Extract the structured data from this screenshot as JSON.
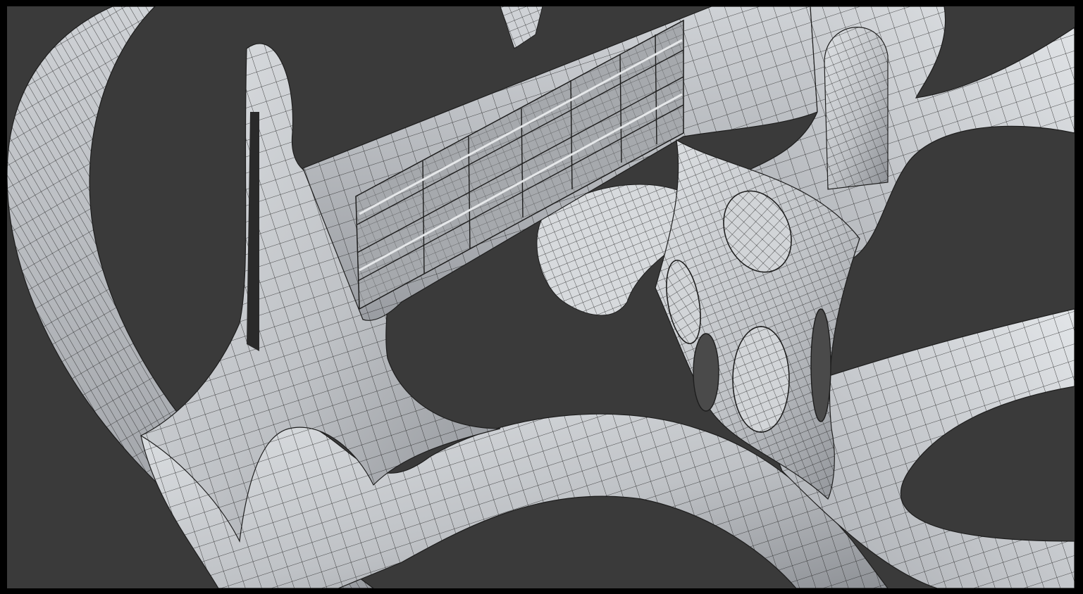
{
  "viewport": {
    "background_color": "#3a3a3a",
    "frame_color": "#000000",
    "mesh_fill": "#bfc2c6",
    "mesh_fill_light": "#dde0e3",
    "mesh_fill_dark": "#8e9196",
    "wire_color": "#1e1e1e"
  },
  "scene": {
    "description_tag": "3d-wireframe-mesh",
    "objects": [
      "organic-ring-frame",
      "window-beam",
      "branching-struts",
      "perforated-column",
      "upper-tower"
    ]
  }
}
